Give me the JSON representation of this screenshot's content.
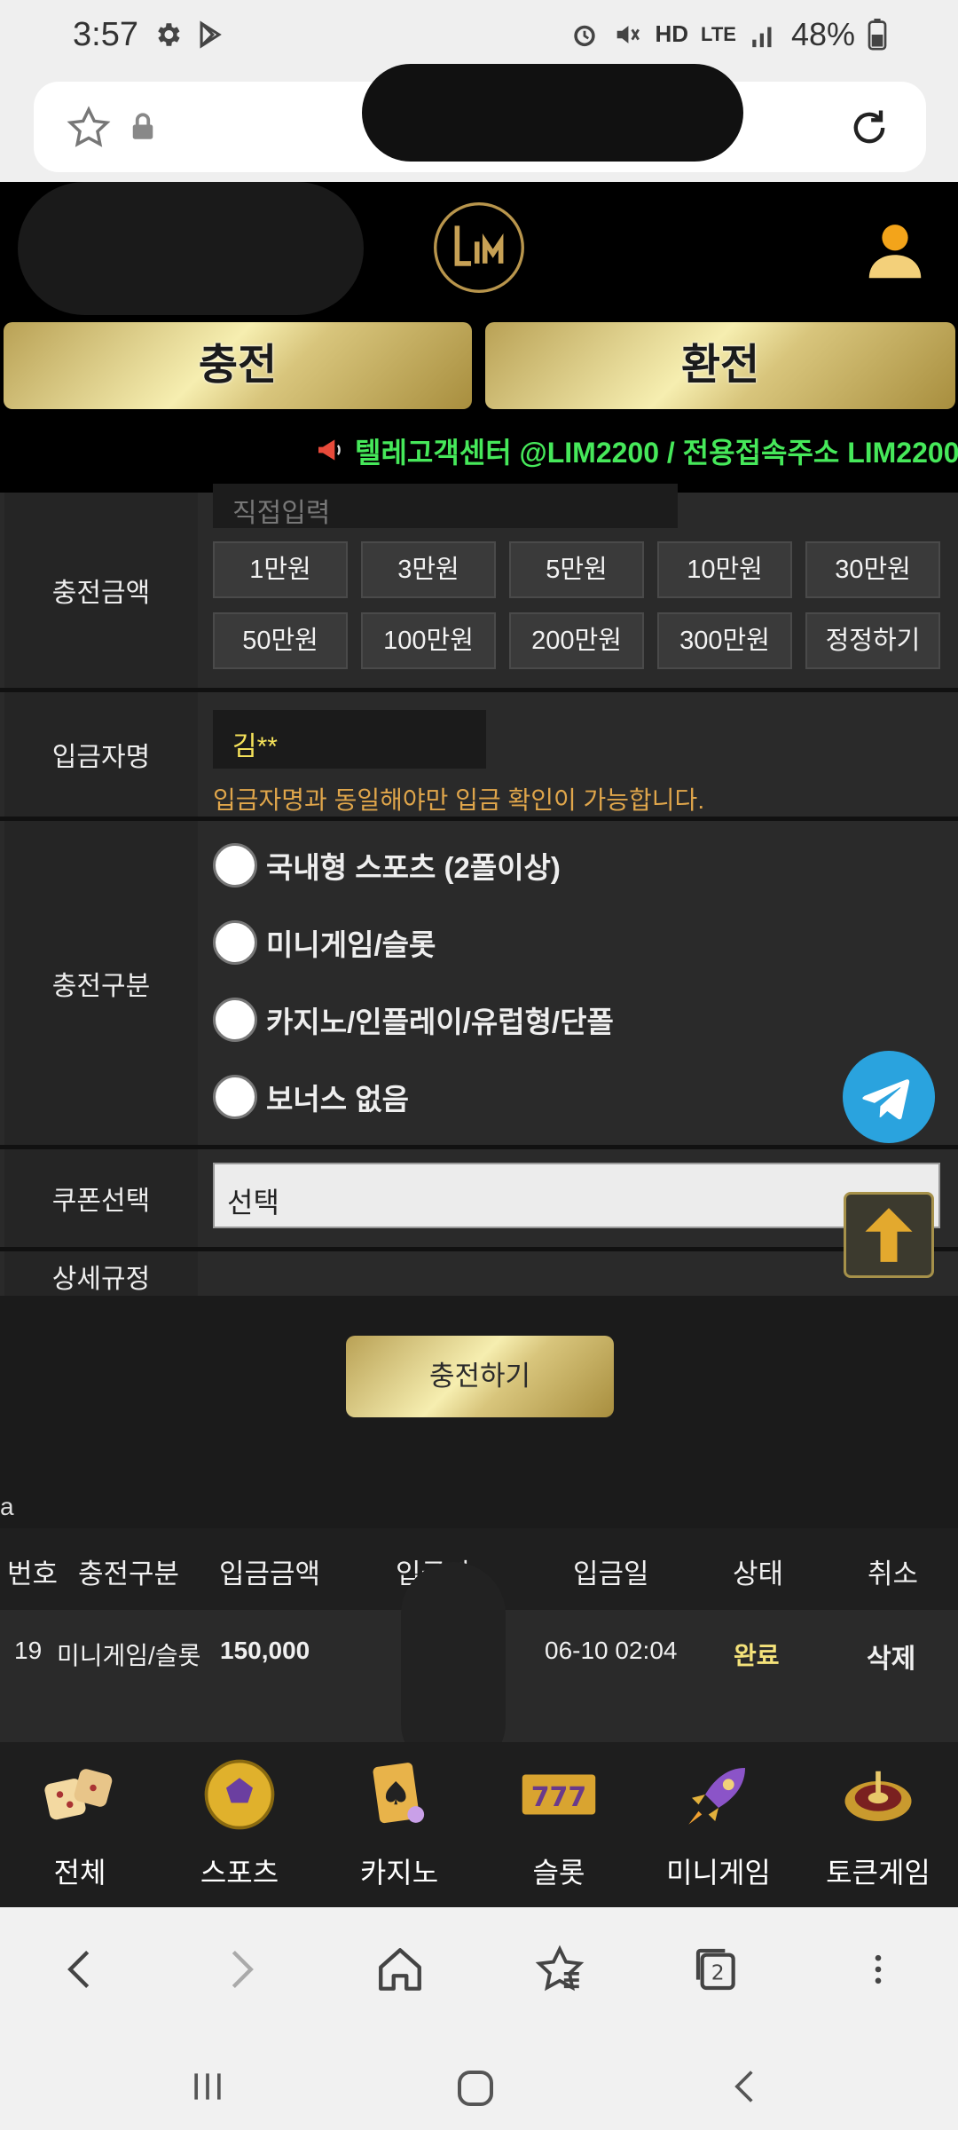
{
  "status_bar": {
    "time": "3:57",
    "battery": "48%",
    "hd_label": "HD",
    "lte_label": "LTE"
  },
  "header": {
    "charge_button": "충전",
    "exchange_button": "환전"
  },
  "ticker": {
    "text": "텔레고객센터 @LIM2200 / 전용접속주소 LIM2200."
  },
  "form": {
    "amount_label": "충전금액",
    "amount_placeholder": "직접입력",
    "amount_buttons": [
      "1만원",
      "3만원",
      "5만원",
      "10만원",
      "30만원",
      "50만원",
      "100만원",
      "200만원",
      "300만원",
      "정정하기"
    ],
    "depositor_label": "입금자명",
    "depositor_value": "김**",
    "depositor_note": "입금자명과 동일해야만 입금 확인이 가능합니다.",
    "type_label": "충전구분",
    "type_options": [
      "국내형 스포츠 (2폴이상)",
      "미니게임/슬롯",
      "카지노/인플레이/유럽형/단폴",
      "보너스 없음"
    ],
    "coupon_label": "쿠폰선택",
    "coupon_value": "선택",
    "rules_label": "상세규정",
    "submit": "충전하기"
  },
  "history": {
    "caption": "a",
    "headers": [
      "번호",
      "충전구분",
      "입금금액",
      "입금자",
      "입금일",
      "상태",
      "취소"
    ],
    "rows": [
      {
        "no": "19",
        "type": "미니게임/슬롯",
        "amount": "150,000",
        "depositor": "",
        "date": "06-10 02:04",
        "status": "완료",
        "cancel": "삭제"
      }
    ]
  },
  "game_nav": [
    "전체",
    "스포츠",
    "카지노",
    "슬롯",
    "미니게임",
    "토큰게임"
  ],
  "colors": {
    "gold": "#e8d88f",
    "ticker_green": "#46e85a",
    "note_orange": "#e0a64b",
    "status_yellow": "#f4e27a"
  }
}
